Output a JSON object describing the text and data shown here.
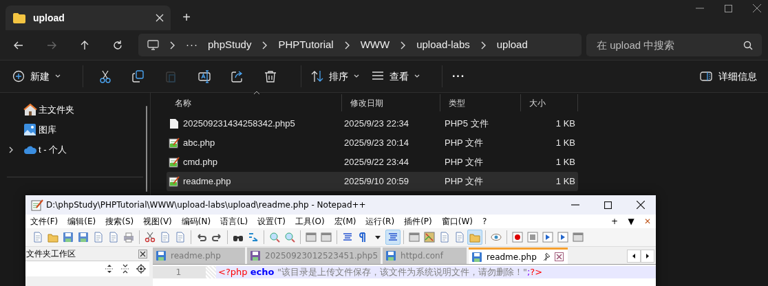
{
  "explorer": {
    "tab": {
      "title": "upload"
    },
    "new_tab": "+",
    "breadcrumb": {
      "overflow": "···",
      "items": [
        "phpStudy",
        "PHPTutorial",
        "WWW",
        "upload-labs",
        "upload"
      ]
    },
    "search": {
      "placeholder": "在 upload 中搜索"
    },
    "toolbar": [
      {
        "kind": "new",
        "label": "新建",
        "disabled": false
      },
      {
        "kind": "separator"
      },
      {
        "kind": "cut",
        "disabled": false
      },
      {
        "kind": "copy",
        "disabled": false
      },
      {
        "kind": "paste",
        "disabled": true
      },
      {
        "kind": "rename",
        "disabled": false
      },
      {
        "kind": "share",
        "disabled": false
      },
      {
        "kind": "delete",
        "disabled": false
      },
      {
        "kind": "separator"
      },
      {
        "kind": "sort",
        "label": "排序",
        "disabled": false
      },
      {
        "kind": "view",
        "label": "查看",
        "disabled": false
      },
      {
        "kind": "separator"
      },
      {
        "kind": "more",
        "label": "···",
        "disabled": false
      }
    ],
    "details_button": "详细信息",
    "sidebar": [
      {
        "kind": "home",
        "label": "主文件夹",
        "expandable": false
      },
      {
        "kind": "gallery",
        "label": "图库",
        "expandable": false
      },
      {
        "kind": "cloud",
        "label": "t - 个人",
        "expandable": true
      }
    ],
    "table": {
      "columns": [
        "名称",
        "修改日期",
        "类型",
        "大小"
      ],
      "rows": [
        {
          "kind": "file",
          "name": "202509231434258342.php5",
          "date": "2025/9/23 22:34",
          "type": "PHP5 文件",
          "size": "1 KB",
          "selected": false
        },
        {
          "kind": "script",
          "name": "abc.php",
          "date": "2025/9/23 20:14",
          "type": "PHP 文件",
          "size": "1 KB",
          "selected": false
        },
        {
          "kind": "script",
          "name": "cmd.php",
          "date": "2025/9/22 23:44",
          "type": "PHP 文件",
          "size": "1 KB",
          "selected": false
        },
        {
          "kind": "script",
          "name": "readme.php",
          "date": "2025/9/10 20:59",
          "type": "PHP 文件",
          "size": "1 KB",
          "selected": true
        }
      ]
    }
  },
  "notepad": {
    "title": "D:\\phpStudy\\PHPTutorial\\WWW\\upload-labs\\upload\\readme.php - Notepad++",
    "menu": [
      "文件(F)",
      "编辑(E)",
      "搜索(S)",
      "视图(V)",
      "编码(N)",
      "语言(L)",
      "设置(T)",
      "工具(O)",
      "宏(M)",
      "运行(R)",
      "插件(P)",
      "窗口(W)",
      "?"
    ],
    "menu_right": [
      "+",
      "▼",
      "✕"
    ],
    "toolbar": [
      {
        "kind": "doc",
        "active": false
      },
      {
        "kind": "folder",
        "active": false
      },
      {
        "kind": "disk",
        "active": false
      },
      {
        "kind": "disk",
        "active": false
      },
      {
        "kind": "doc",
        "active": false
      },
      {
        "kind": "doc",
        "active": false
      },
      {
        "kind": "printer",
        "active": false
      },
      {
        "kind": "separator"
      },
      {
        "kind": "scissors",
        "active": false
      },
      {
        "kind": "doc",
        "active": false
      },
      {
        "kind": "doc",
        "active": false
      },
      {
        "kind": "separator"
      },
      {
        "kind": "undo",
        "active": false
      },
      {
        "kind": "redo",
        "active": false
      },
      {
        "kind": "separator"
      },
      {
        "kind": "binoculars",
        "active": false
      },
      {
        "kind": "replace",
        "active": false
      },
      {
        "kind": "separator"
      },
      {
        "kind": "magnifier",
        "active": false
      },
      {
        "kind": "magnifier",
        "active": false
      },
      {
        "kind": "separator"
      },
      {
        "kind": "window",
        "active": false
      },
      {
        "kind": "window",
        "active": false
      },
      {
        "kind": "separator"
      },
      {
        "kind": "lines",
        "active": false
      },
      {
        "kind": "pilcrow",
        "active": false
      },
      {
        "kind": "dropdown",
        "active": false
      },
      {
        "kind": "lines",
        "active": true
      },
      {
        "kind": "separator"
      },
      {
        "kind": "window",
        "active": false
      },
      {
        "kind": "map",
        "active": false
      },
      {
        "kind": "doc",
        "active": false
      },
      {
        "kind": "doc",
        "active": false
      },
      {
        "kind": "folder",
        "active": true
      },
      {
        "kind": "separator"
      },
      {
        "kind": "eye",
        "active": false
      },
      {
        "kind": "separator"
      },
      {
        "kind": "record",
        "active": false
      },
      {
        "kind": "stop",
        "active": false
      },
      {
        "kind": "play",
        "active": false
      },
      {
        "kind": "play",
        "active": false
      },
      {
        "kind": "window",
        "active": false
      }
    ],
    "panel": {
      "title": "文件夹工作区"
    },
    "tabs": [
      {
        "label": "readme.php",
        "selected": false
      },
      {
        "label": "20250923012523451.php5",
        "selected": false
      },
      {
        "label": "httpd.conf",
        "selected": false
      },
      {
        "label": "readme.php",
        "selected": true
      }
    ],
    "lines": [
      {
        "number": "1",
        "current": true,
        "tokens": [
          {
            "text": "<?php ",
            "kind": "tag"
          },
          {
            "text": "echo ",
            "kind": "keyword"
          },
          {
            "text": "\"该目录是上传文件保存，该文件为系统说明文件，请勿删除！\"",
            "kind": "string"
          },
          {
            "text": ";",
            "kind": "operator"
          },
          {
            "text": "?>",
            "kind": "tag"
          }
        ]
      }
    ]
  }
}
